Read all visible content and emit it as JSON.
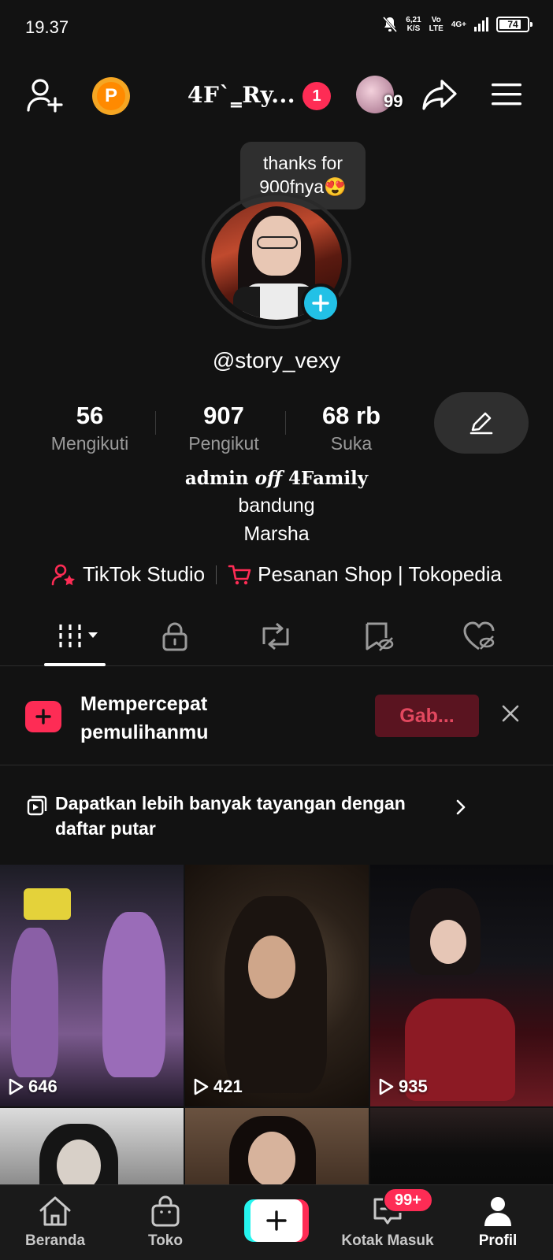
{
  "status_bar": {
    "time": "19.37",
    "net_speed": "6,21",
    "net_unit": "K/S",
    "volte_top": "Vo",
    "volte_bottom": "LTE",
    "network": "4G+",
    "battery": "74"
  },
  "header": {
    "account_name": "4F`‗Ry...",
    "account_badge": "1",
    "friends_count": "99",
    "icons": [
      "add-friend-icon",
      "points-coin-icon",
      "share-icon",
      "menu-icon"
    ]
  },
  "profile": {
    "note": "thanks for 900fnya😍",
    "username": "@story_vexy",
    "stats": [
      {
        "value": "56",
        "label": "Mengikuti"
      },
      {
        "value": "907",
        "label": "Pengikut"
      },
      {
        "value": "68 rb",
        "label": "Suka"
      }
    ],
    "bio_title_pre": "admin ",
    "bio_title_italic": "off",
    "bio_title_post": " 4Family",
    "bio_line2": "bandung",
    "bio_line3": "Marsha",
    "links": {
      "studio": "TikTok Studio",
      "shop": "Pesanan Shop | Tokopedia"
    }
  },
  "tabs": [
    "videos-grid-icon",
    "private-lock-icon",
    "repost-icon",
    "favorites-icon",
    "liked-icon"
  ],
  "banner": {
    "text": "Mempercepat pemulihanmu",
    "button": "Gab..."
  },
  "playlist": {
    "text": "Dapatkan lebih banyak tayangan dengan daftar putar"
  },
  "videos": [
    {
      "views": "646"
    },
    {
      "views": "421"
    },
    {
      "views": "935"
    }
  ],
  "bottom_nav": {
    "home": "Beranda",
    "shop": "Toko",
    "inbox": "Kotak Masuk",
    "inbox_badge": "99+",
    "profile": "Profil"
  },
  "colors": {
    "accent": "#fe2c55",
    "cyan": "#25f4ee",
    "background": "#121212"
  }
}
